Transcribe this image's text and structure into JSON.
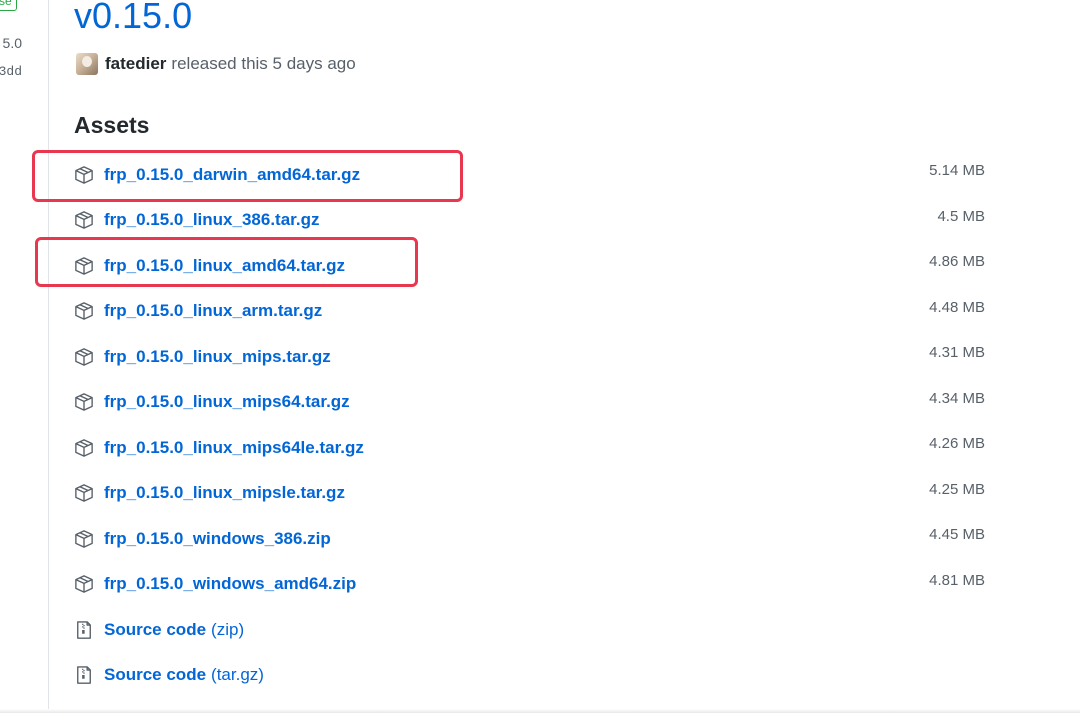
{
  "sidebar": {
    "badge": "se",
    "version": "5.0",
    "commit": "3dd"
  },
  "release": {
    "title": "v0.15.0",
    "author": "fatedier",
    "released_text": "released this 5 days ago"
  },
  "assets": {
    "heading": "Assets",
    "items": [
      {
        "name": "frp_0.15.0_darwin_amd64.tar.gz",
        "size": "5.14 MB",
        "icon": "package-icon"
      },
      {
        "name": "frp_0.15.0_linux_386.tar.gz",
        "size": "4.5 MB",
        "icon": "package-icon"
      },
      {
        "name": "frp_0.15.0_linux_amd64.tar.gz",
        "size": "4.86 MB",
        "icon": "package-icon"
      },
      {
        "name": "frp_0.15.0_linux_arm.tar.gz",
        "size": "4.48 MB",
        "icon": "package-icon"
      },
      {
        "name": "frp_0.15.0_linux_mips.tar.gz",
        "size": "4.31 MB",
        "icon": "package-icon"
      },
      {
        "name": "frp_0.15.0_linux_mips64.tar.gz",
        "size": "4.34 MB",
        "icon": "package-icon"
      },
      {
        "name": "frp_0.15.0_linux_mips64le.tar.gz",
        "size": "4.26 MB",
        "icon": "package-icon"
      },
      {
        "name": "frp_0.15.0_linux_mipsle.tar.gz",
        "size": "4.25 MB",
        "icon": "package-icon"
      },
      {
        "name": "frp_0.15.0_windows_386.zip",
        "size": "4.45 MB",
        "icon": "package-icon"
      },
      {
        "name": "frp_0.15.0_windows_amd64.zip",
        "size": "4.81 MB",
        "icon": "package-icon"
      }
    ],
    "source": [
      {
        "name": "Source code",
        "suffix": "(zip)",
        "icon": "file-zip-icon"
      },
      {
        "name": "Source code",
        "suffix": "(tar.gz)",
        "icon": "file-zip-icon"
      }
    ]
  },
  "colors": {
    "link": "#0366d6",
    "highlight": "#e8384f",
    "muted": "#586069",
    "badge": "#28a745"
  }
}
